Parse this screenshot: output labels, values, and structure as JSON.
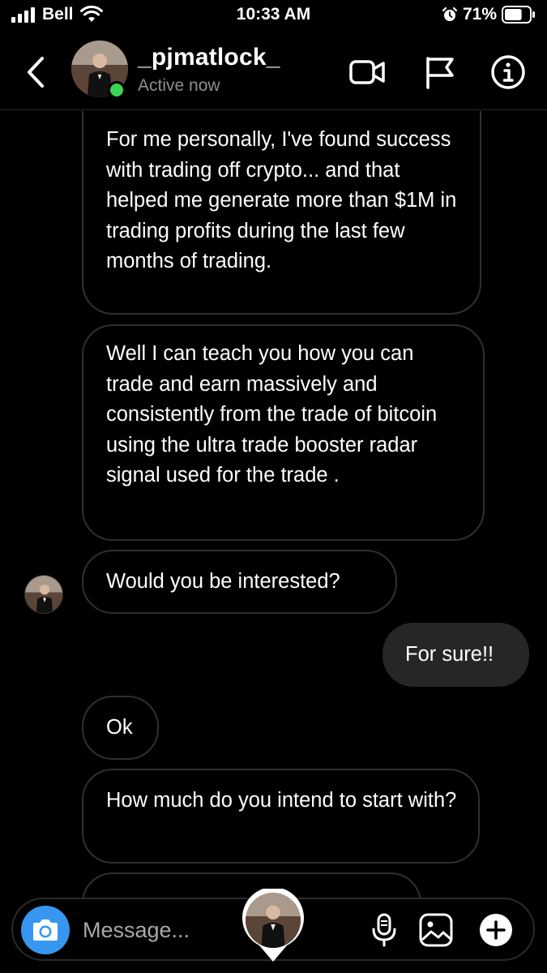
{
  "status_bar": {
    "carrier": "Bell",
    "time": "10:33 AM",
    "battery_percent": "71%",
    "battery_level": 0.71,
    "icons": [
      "signal-icon",
      "wifi-icon",
      "alarm-icon",
      "battery-icon"
    ]
  },
  "header": {
    "username": "_pjmatlock_",
    "status": "Active now",
    "icons": [
      "back-icon",
      "video-call-icon",
      "flag-icon",
      "info-icon"
    ]
  },
  "messages": [
    {
      "from": "them",
      "text": "For me personally, I've found success with trading off crypto... and that helped me generate more than $1M in trading profits during the last few months of trading."
    },
    {
      "from": "them",
      "text": "Well I can teach you how you can trade and earn massively and consistently from the trade of bitcoin using the ultra trade booster radar signal used for the trade ."
    },
    {
      "from": "them",
      "text": "Would you be interested?"
    },
    {
      "from": "me",
      "text": "For sure!!"
    },
    {
      "from": "them",
      "text": "Ok"
    },
    {
      "from": "them",
      "text": "How much do you intend to start with?"
    }
  ],
  "composer": {
    "placeholder": "Message...",
    "icons": [
      "camera-icon",
      "microphone-icon",
      "gallery-icon",
      "plus-icon"
    ]
  },
  "colors": {
    "background": "#000000",
    "incoming_border": "#303030",
    "outgoing_bubble": "#262626",
    "camera_button": "#3797f0",
    "active_dot": "#3ad552",
    "secondary_text": "#8e8e8e"
  }
}
